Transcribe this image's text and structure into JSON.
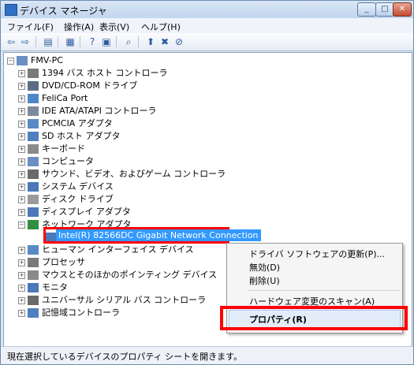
{
  "window": {
    "title": "デバイス マネージャ"
  },
  "titlebar": {
    "min": "_",
    "max": "□",
    "close": "✕"
  },
  "menu": [
    "ファイル(F)",
    "操作(A)",
    "表示(V)",
    "ヘルプ(H)"
  ],
  "toolbar": {
    "icons": [
      "back-icon",
      "forward-icon",
      "console-tree-icon",
      "properties-icon",
      "help-icon",
      "view-icon",
      "scan-hardware-icon",
      "update-driver-icon",
      "uninstall-icon",
      "disable-icon"
    ]
  },
  "tree": {
    "root": "FMV-PC",
    "items": [
      "1394 バス ホスト コントローラ",
      "DVD/CD-ROM ドライブ",
      "FeliCa Port",
      "IDE ATA/ATAPI コントローラ",
      "PCMCIA アダプタ",
      "SD ホスト アダプタ",
      "キーボード",
      "コンピュータ",
      "サウンド、ビデオ、およびゲーム コントローラ",
      "システム デバイス",
      "ディスク ドライブ",
      "ディスプレイ アダプタ",
      "ネットワーク アダプタ"
    ],
    "selected_child": "Intel(R) 82566DC Gigabit Network Connection",
    "items_after": [
      "ヒューマン インターフェイス デバイス",
      "プロセッサ",
      "マウスとそのほかのポインティング デバイス",
      "モニタ",
      "ユニバーサル シリアル バス コントローラ",
      "記憶域コントローラ"
    ]
  },
  "context_menu": {
    "update_driver": "ドライバ ソフトウェアの更新(P)...",
    "disable": "無効(D)",
    "uninstall": "削除(U)",
    "scan": "ハードウェア変更のスキャン(A)",
    "properties": "プロパティ(R)"
  },
  "status": {
    "text": "現在選択しているデバイスのプロパティ シートを開きます。"
  },
  "colors": {
    "selection": "#3399ff",
    "highlight_border": "#ff0000"
  }
}
